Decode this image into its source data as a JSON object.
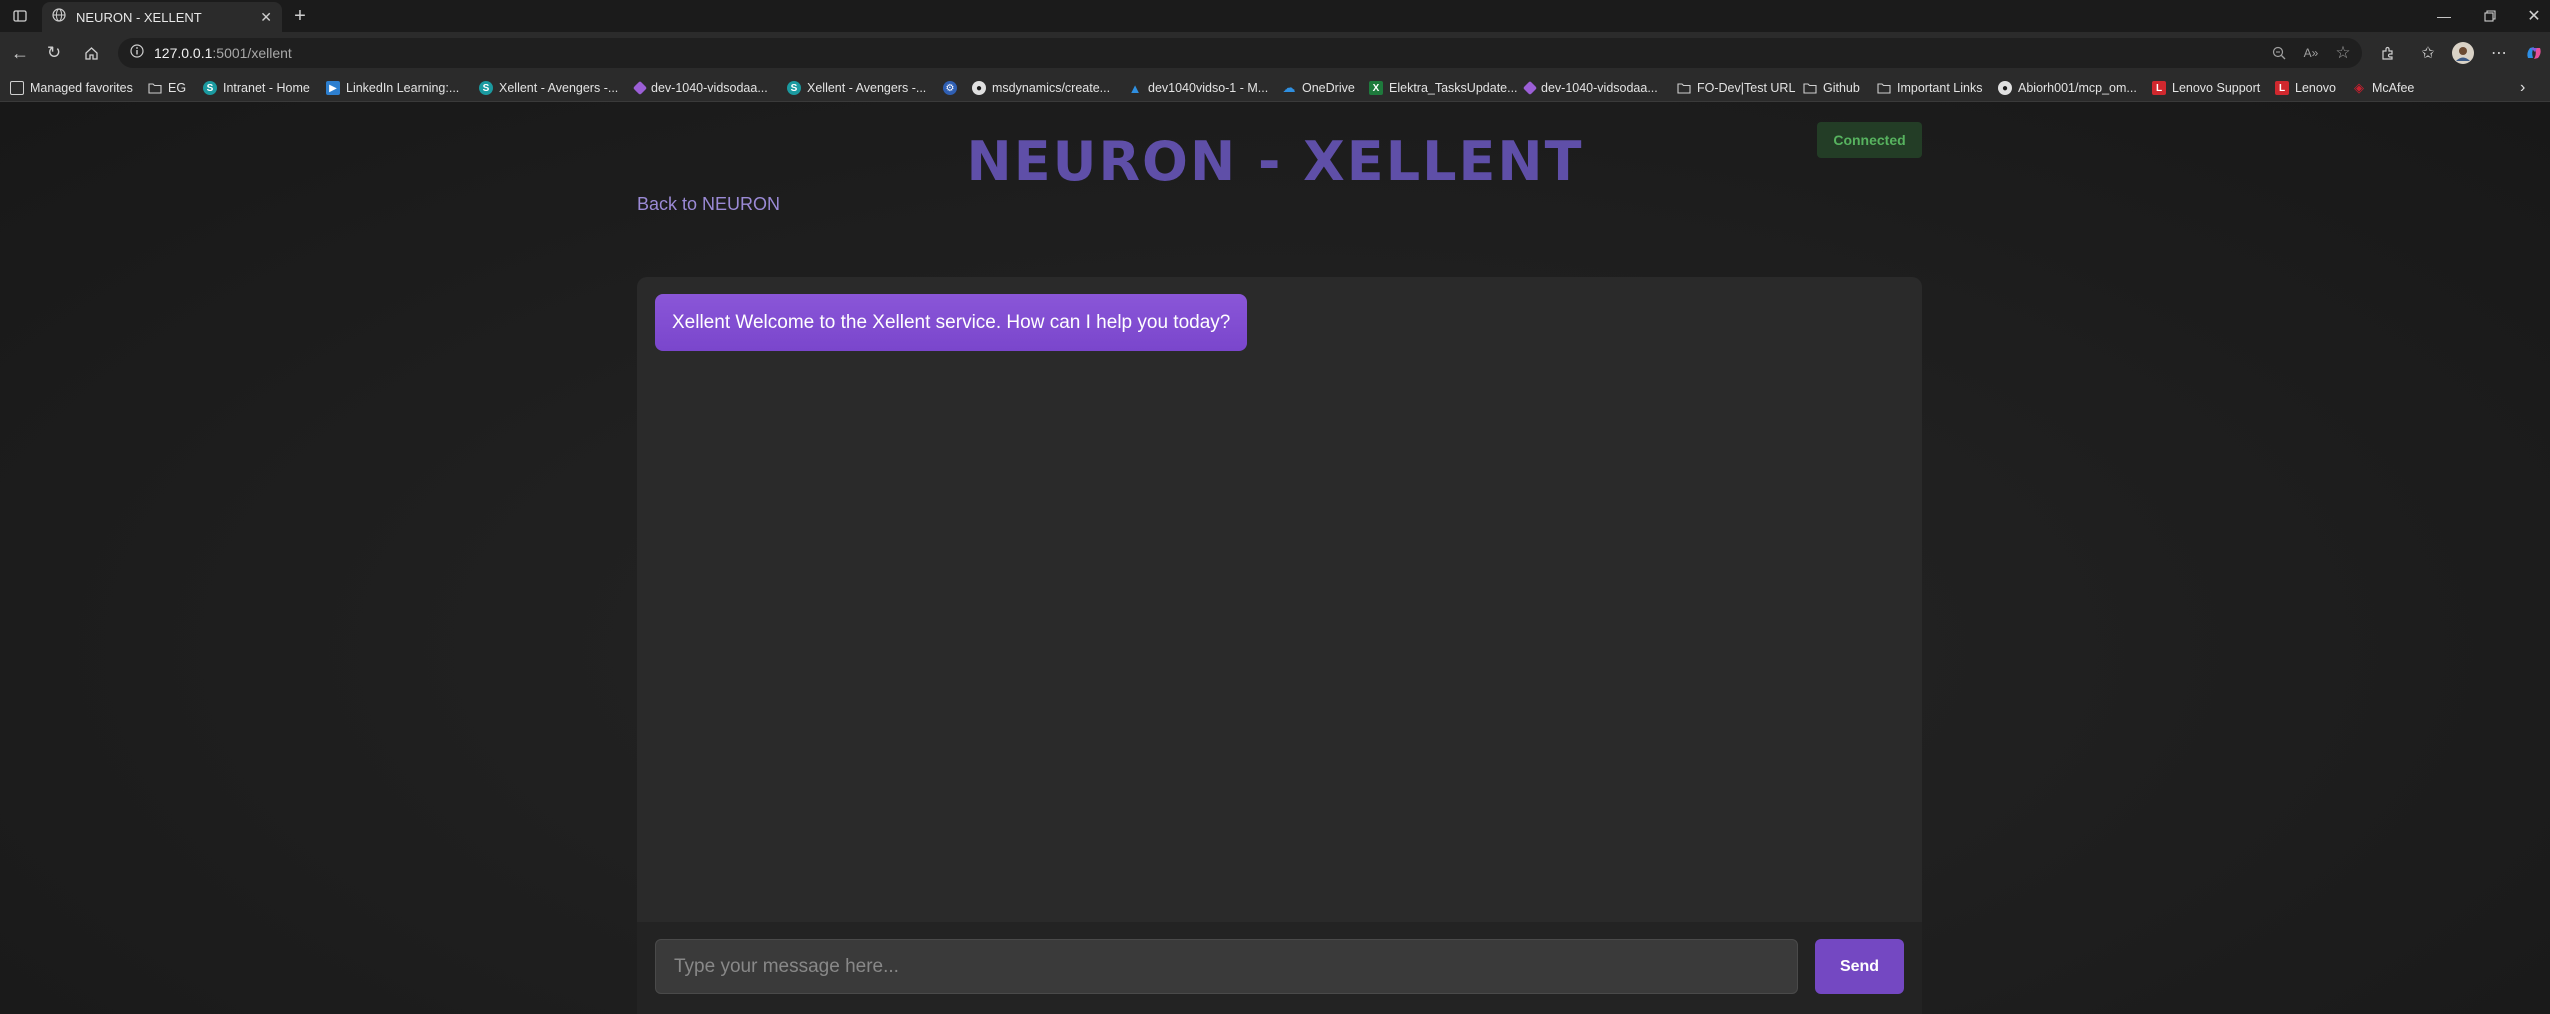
{
  "browser": {
    "tab": {
      "title": "NEURON - XELLENT"
    },
    "address": {
      "host": "127.0.0.1",
      "path": ":5001/xellent"
    },
    "favorites": [
      {
        "label": "Managed favorites",
        "icon": "managed-favorites-icon",
        "color": "#cfcfcf"
      },
      {
        "label": "EG",
        "icon": "folder-icon",
        "color": "#cfcfcf"
      },
      {
        "label": "Intranet - Home",
        "icon": "sharepoint-icon",
        "color": "#1b9aa0"
      },
      {
        "label": "LinkedIn Learning:...",
        "icon": "linkedin-learning-icon",
        "color": "#2d7fcf"
      },
      {
        "label": "Xellent - Avengers -...",
        "icon": "sharepoint-icon",
        "color": "#1b9aa0"
      },
      {
        "label": "dev-1040-vidsodaa...",
        "icon": "power-apps-icon",
        "color": "#9b5fd6"
      },
      {
        "label": "Xellent - Avengers -...",
        "icon": "sharepoint-icon",
        "color": "#1b9aa0"
      },
      {
        "label": "",
        "icon": "tools-icon",
        "color": "#2f5fb3"
      },
      {
        "label": "msdynamics/create...",
        "icon": "github-icon",
        "color": "#e0e0e0"
      },
      {
        "label": "dev1040vidso-1 - M...",
        "icon": "azure-icon",
        "color": "#2f8fe0"
      },
      {
        "label": "OneDrive",
        "icon": "onedrive-icon",
        "color": "#2f8fe0"
      },
      {
        "label": "Elektra_TasksUpdate...",
        "icon": "excel-icon",
        "color": "#1e7a3c"
      },
      {
        "label": "dev-1040-vidsodaa...",
        "icon": "power-apps-icon",
        "color": "#9b5fd6"
      },
      {
        "label": "FO-Dev|Test URL",
        "icon": "folder-icon",
        "color": "#cfcfcf"
      },
      {
        "label": "Github",
        "icon": "folder-icon",
        "color": "#cfcfcf"
      },
      {
        "label": "Important Links",
        "icon": "folder-icon",
        "color": "#cfcfcf"
      },
      {
        "label": "Abiorh001/mcp_om...",
        "icon": "github-icon",
        "color": "#e0e0e0"
      },
      {
        "label": "Lenovo Support",
        "icon": "lenovo-icon",
        "color": "#d0282e"
      },
      {
        "label": "Lenovo",
        "icon": "lenovo-icon",
        "color": "#d0282e"
      },
      {
        "label": "McAfee",
        "icon": "mcafee-icon",
        "color": "#c8202f"
      }
    ]
  },
  "page": {
    "title": "NEURON - XELLENT",
    "back_link": "Back to NEURON",
    "status": "Connected"
  },
  "chat": {
    "messages": [
      {
        "text": "Xellent Welcome to the Xellent service. How can I help you today?"
      }
    ],
    "input": {
      "placeholder": "Type your message here...",
      "value": ""
    },
    "send_label": "Send"
  },
  "colors": {
    "accent": "#7448c2",
    "title": "#5f4fa8",
    "status_text": "#57b35f",
    "status_bg": "#233d26"
  }
}
